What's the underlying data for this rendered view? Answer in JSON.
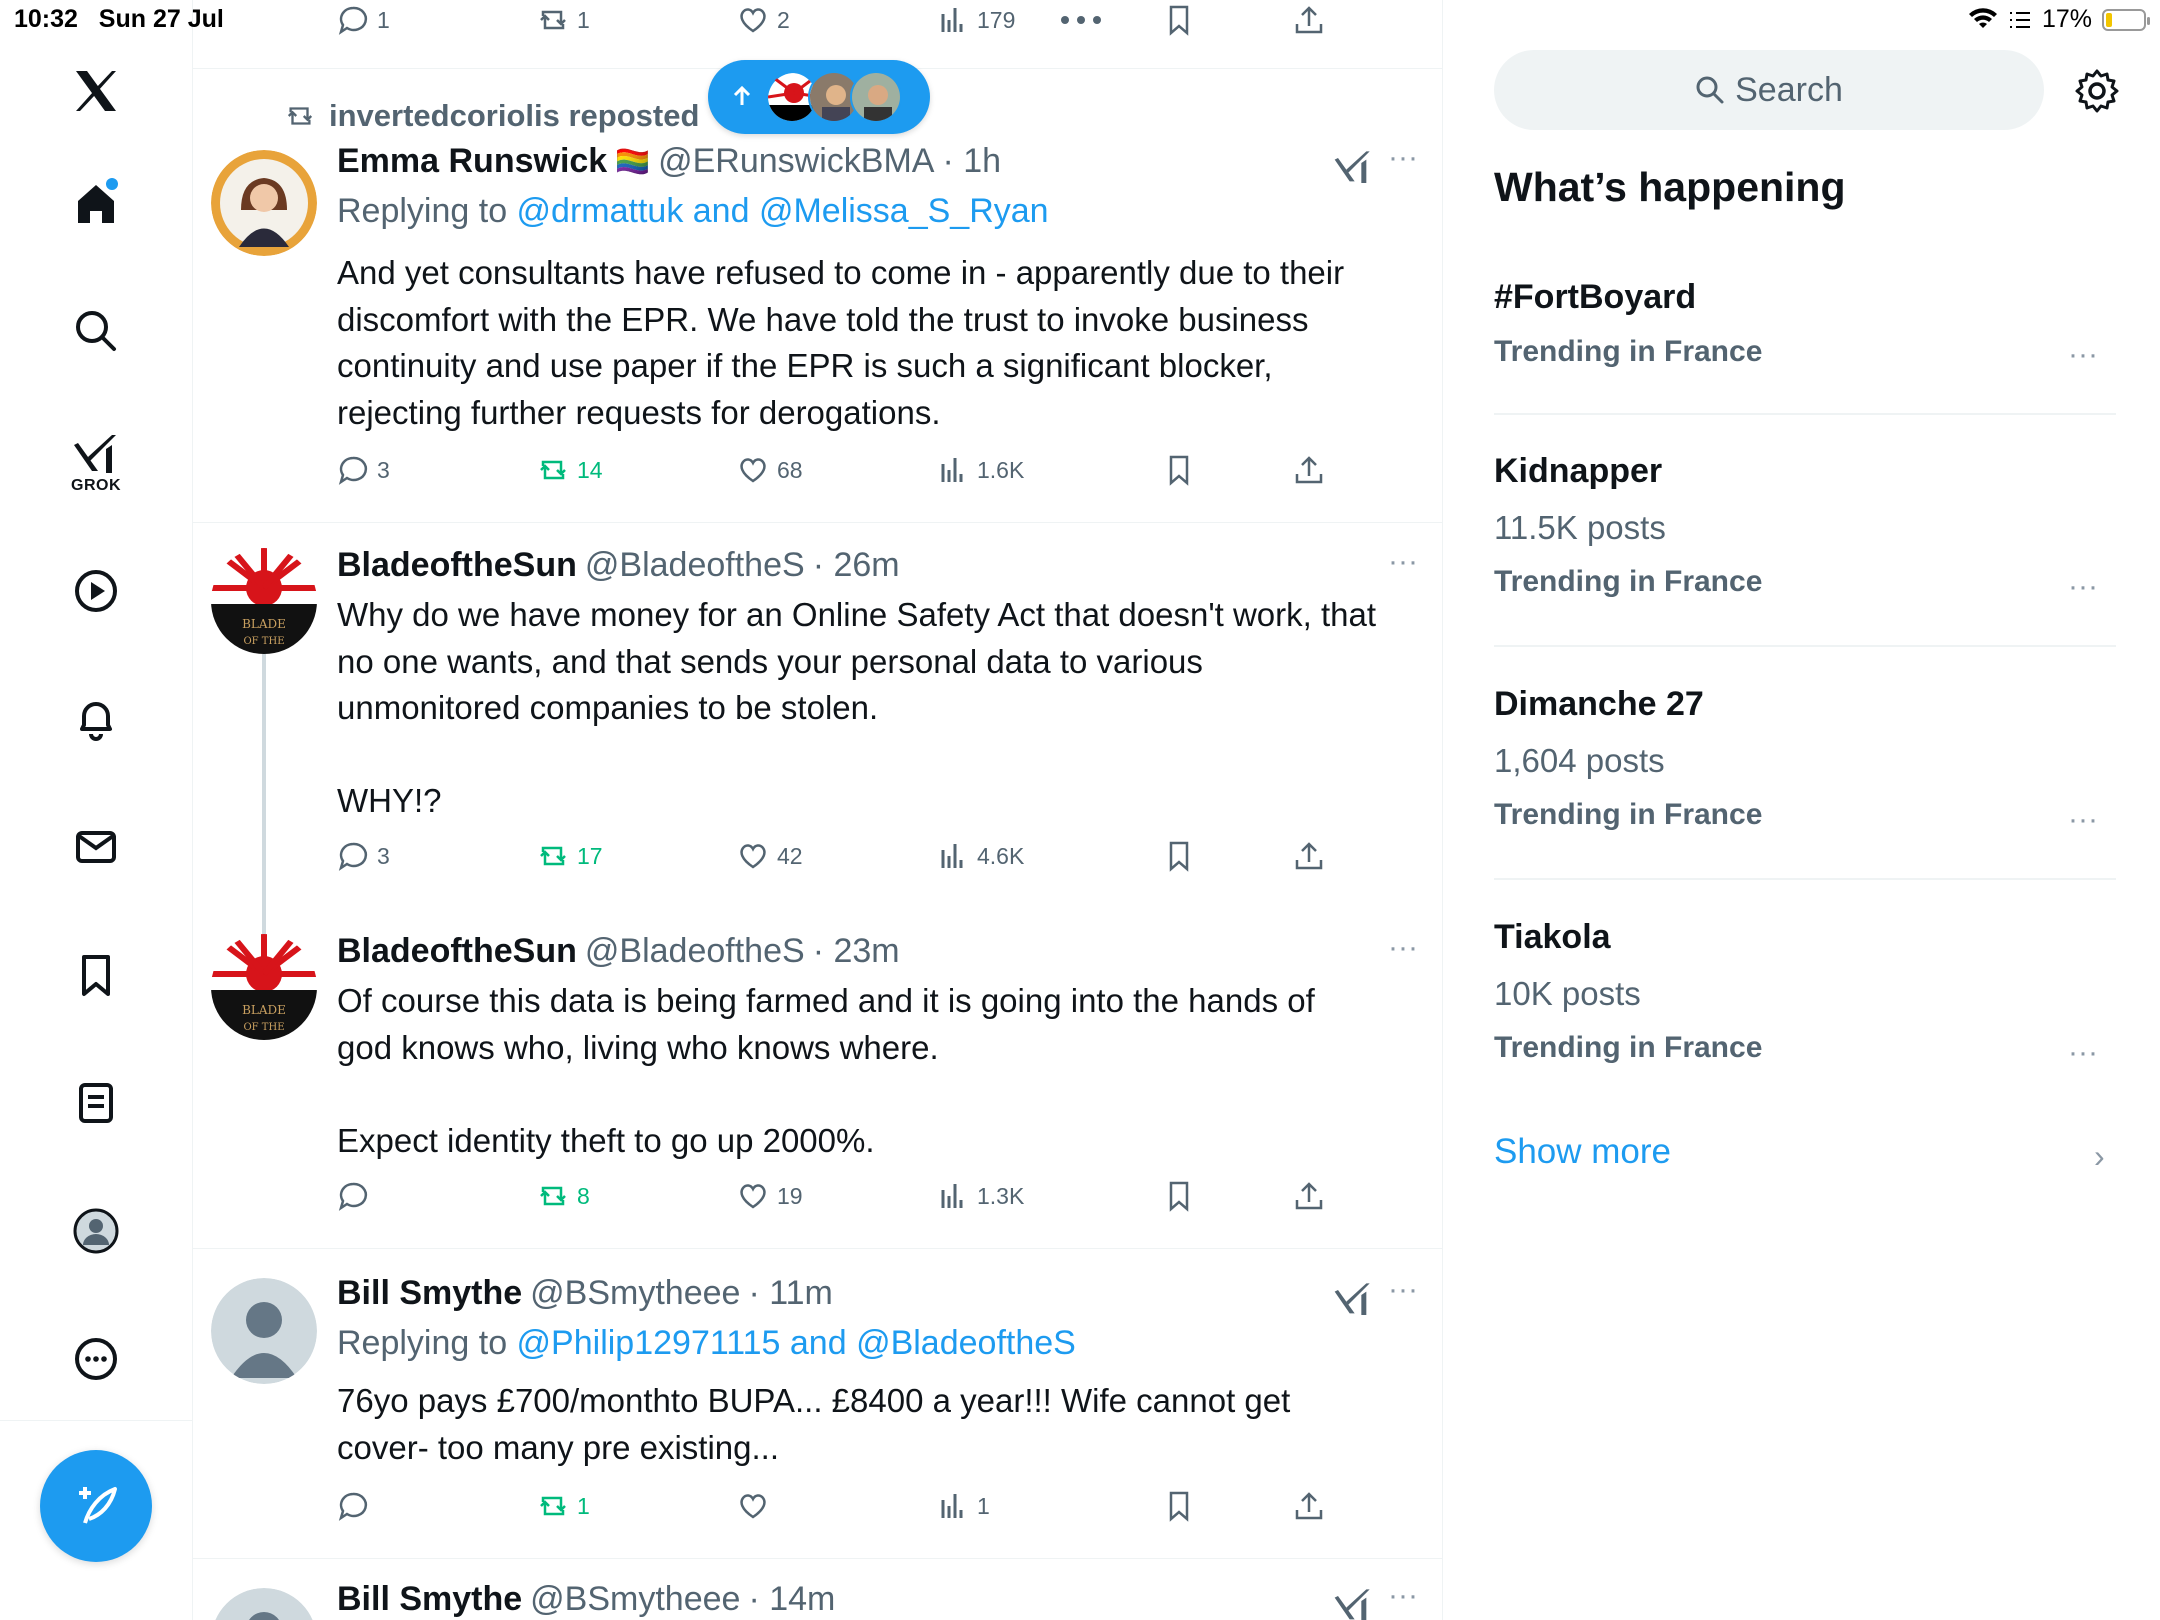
{
  "status_bar": {
    "time": "10:32",
    "date": "Sun 27 Jul",
    "battery": "17%",
    "battery_level": 0.17
  },
  "colors": {
    "accent": "#1d9bf0",
    "green": "#00ba7c",
    "muted": "#536471"
  },
  "nav": {
    "logo": "x-logo-icon",
    "items": [
      "home-icon",
      "search-icon",
      "grok-icon",
      "video-icon",
      "notifications-icon",
      "messages-icon",
      "bookmarks-icon",
      "lists-icon",
      "profile-icon",
      "more-icon"
    ],
    "grok_label": "GROK",
    "compose_icon": "compose-feather-icon"
  },
  "top_actions": {
    "replies": "1",
    "reposts": "1",
    "likes": "2",
    "views": "179"
  },
  "new_posts_pill": {
    "icon": "arrow-up-icon"
  },
  "tweets": [
    {
      "repost_by": "invertedcoriolis reposted",
      "name": "Emma Runswick",
      "flag": "🏳️‍🌈",
      "handle": "@ERunswickBMA",
      "time": "· 1h",
      "replying_prefix": "Replying to ",
      "replying_to": "@drmattuk and @Melissa_S_Ryan",
      "text": "And yet consultants have refused to come in - apparently due to their\ndiscomfort with the EPR. We have told the trust to invoke business\ncontinuity and use paper if the EPR is such a significant blocker,\nrejecting further requests for derogations.",
      "replies": "3",
      "reposts": "14",
      "likes": "68",
      "views": "1.6K"
    },
    {
      "name": "BladeoftheSun",
      "handle": "@BladeoftheS",
      "time": "· 26m",
      "text": "Why do we have money for an Online Safety Act that doesn't work, that\nno one wants, and that sends your personal data to various\nunmonitored companies to be stolen.\n\nWHY!?",
      "replies": "3",
      "reposts": "17",
      "likes": "42",
      "views": "4.6K"
    },
    {
      "name": "BladeoftheSun",
      "handle": "@BladeoftheS",
      "time": "· 23m",
      "text": "Of course this data is being farmed and it is going into the hands of\ngod knows who, living who knows where.\n\nExpect identity theft to go up 2000%.",
      "replies": "",
      "reposts": "8",
      "likes": "19",
      "views": "1.3K"
    },
    {
      "name": "Bill Smythe",
      "handle": "@BSmytheee",
      "time": "· 11m",
      "replying_prefix": "Replying to ",
      "replying_to": "@Philip12971115 and @BladeoftheS",
      "text": "76yo pays £700/monthto BUPA... £8400 a year!!! Wife cannot get\ncover- too many pre existing...",
      "replies": "",
      "reposts": "1",
      "likes": "",
      "views": "1"
    },
    {
      "name": "Bill Smythe",
      "handle": "@BSmytheee",
      "time": "· 14m"
    }
  ],
  "sidebar": {
    "search_placeholder": "Search",
    "heading": "What’s happening",
    "trends": [
      {
        "title": "#FortBoyard",
        "posts": "",
        "location": "Trending in France"
      },
      {
        "title": "Kidnapper",
        "posts": "11.5K posts",
        "location": "Trending in France"
      },
      {
        "title": "Dimanche 27",
        "posts": "1,604 posts",
        "location": "Trending in France"
      },
      {
        "title": "Tiakola",
        "posts": "10K posts",
        "location": "Trending in France"
      }
    ],
    "show_more": "Show more"
  }
}
